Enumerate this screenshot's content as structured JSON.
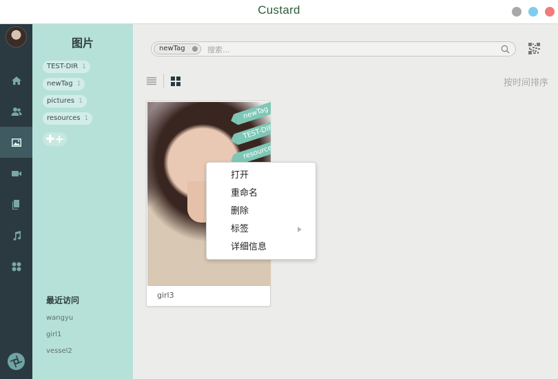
{
  "window": {
    "title": "Custard",
    "controls": [
      "minimize",
      "maximize",
      "close"
    ]
  },
  "rail": {
    "items": [
      {
        "icon": "home-icon"
      },
      {
        "icon": "users-icon"
      },
      {
        "icon": "image-icon",
        "active": true
      },
      {
        "icon": "video-icon"
      },
      {
        "icon": "document-icon"
      },
      {
        "icon": "music-icon"
      },
      {
        "icon": "apps-icon"
      }
    ]
  },
  "sidebar": {
    "heading": "图片",
    "tags": [
      {
        "label": "TEST-DIR",
        "count": "1"
      },
      {
        "label": "newTag",
        "count": "1"
      },
      {
        "label": "pictures",
        "count": "1"
      },
      {
        "label": "resources",
        "count": "1"
      }
    ],
    "add_label": "✚+",
    "recent_heading": "最近访问",
    "recent": [
      "wangyu",
      "girl1",
      "vessel2"
    ]
  },
  "search": {
    "chip": "newTag",
    "placeholder": "搜索..."
  },
  "toolbar": {
    "sort_label": "按时间排序"
  },
  "card": {
    "name": "girl3",
    "tags": [
      "newTag",
      "TEST-DIR",
      "resources"
    ]
  },
  "context_menu": {
    "items": [
      "打开",
      "重命名",
      "删除",
      "标签",
      "详细信息"
    ]
  }
}
